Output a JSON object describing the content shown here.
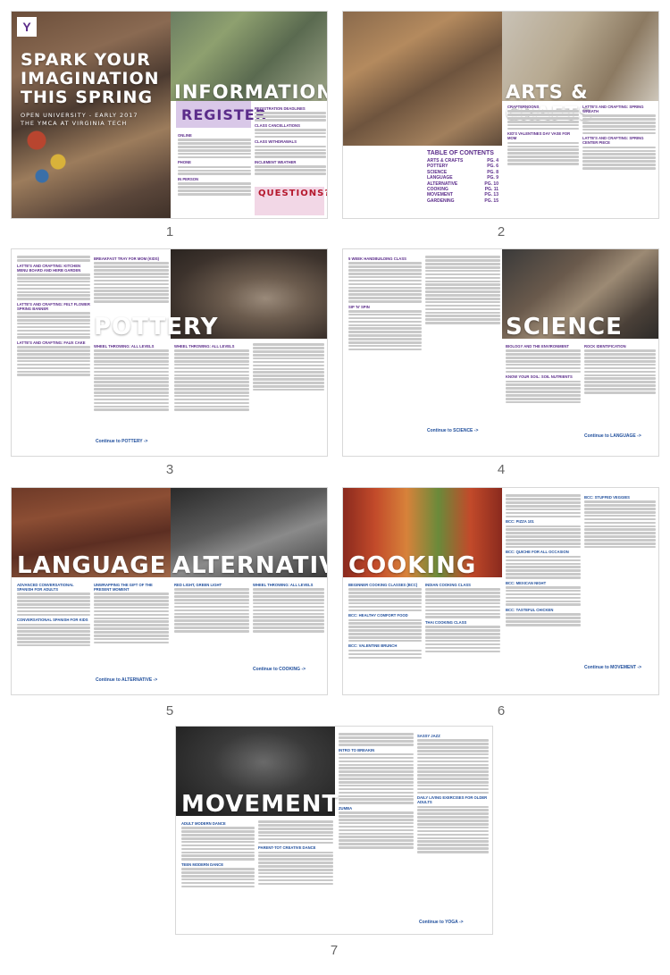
{
  "cover": {
    "headline": "SPARK YOUR IMAGINATION THIS SPRING",
    "line1": "OPEN UNIVERSITY - EARLY 2017",
    "line2": "THE YMCA AT VIRGINIA TECH",
    "logo": "Y",
    "section_title": "INFORMATION",
    "register_title": "REGISTER",
    "questions_title": "QUESTIONS?",
    "sub_online": "ONLINE",
    "sub_phone": "PHONE",
    "sub_in_person": "IN PERSON",
    "col_heads": [
      "REGISTRATION DEADLINES",
      "CLASS CANCELLATIONS",
      "CLASS WITHDRAWALS",
      "INCLEMENT WEATHER"
    ]
  },
  "arts": {
    "section_title": "ARTS & CRAFTS",
    "heads": [
      "CRAFTERNOONS",
      "KID'S VALENTINES DAY VASE FOR MOM",
      "LATTE'S AND CRAFTING: SPRING WREATH",
      "LATTE'S AND CRAFTING: SPRING CENTER PIECE"
    ],
    "toc_title": "TABLE OF CONTENTS",
    "toc": [
      {
        "label": "ARTS & CRAFTS",
        "page": "PG. 4"
      },
      {
        "label": "POTTERY",
        "page": "PG. 6"
      },
      {
        "label": "SCIENCE",
        "page": "PG. 8"
      },
      {
        "label": "LANGUAGE",
        "page": "PG. 9"
      },
      {
        "label": "ALTERNATIVE",
        "page": "PG. 10"
      },
      {
        "label": "COOKING",
        "page": "PG. 11"
      },
      {
        "label": "MOVEMENT",
        "page": "PG. 13"
      },
      {
        "label": "GARDENING",
        "page": "PG. 15"
      }
    ]
  },
  "pottery": {
    "section_title": "POTTERY",
    "heads": [
      "LATTE'S AND CRAFTING: KITCHEN MENU BOARD AND HERB GARDEN",
      "LATTE'S AND CRAFTING: FELT FLOWER SPRING BANNER",
      "LATTE'S AND CRAFTING: FAUX CAKE",
      "BREAKFAST TRAY FOR MOM (KIDS)",
      "WHEEL THROWING: ALL LEVELS",
      "WHEEL THROWING: ALL LEVELS"
    ],
    "continue": "Continue to POTTERY ->"
  },
  "science": {
    "section_title": "SCIENCE",
    "heads": [
      "5 WEEK HANDBUILDING CLASS",
      "SIP 'N' SPIN",
      "BIOLOGY AND THE ENVIRONMENT",
      "KNOW YOUR SOIL: SOIL NUTRIENTS",
      "ROCK IDENTIFICATION"
    ],
    "continue1": "Continue to SCIENCE ->",
    "continue2": "Continue to LANGUAGE ->"
  },
  "language": {
    "section_title_1": "LANGUAGE",
    "section_title_2": "ALTERNATIVE",
    "heads": [
      "ADVANCED CONVERSATIONAL SPANISH FOR ADULTS",
      "CONVERSATIONAL SPANISH FOR KIDS",
      "UNWRAPPING THE GIFT OF THE PRESENT MOMENT",
      "RED LIGHT, GREEN LIGHT",
      "WHEEL THROWING: ALL LEVELS"
    ],
    "continue1": "Continue to ALTERNATIVE ->",
    "continue2": "Continue to COOKING ->"
  },
  "cooking": {
    "section_title": "COOKING",
    "heads": [
      "BEGINNER COOKING CLASSES (BCC)",
      "BCC: HEALTHY COMFORT FOOD",
      "BCC: VALENTINE BRUNCH",
      "INDIAN COOKING CLASS",
      "THAI COOKING CLASS",
      "BCC: STUFFED VEGGIES",
      "BCC: PIZZA 101",
      "BCC: QUICHE FOR ALL OCCASION",
      "BCC: MEXICAN NIGHT",
      "BCC: TASTEFUL CHICKEN"
    ],
    "continue": "Continue to MOVEMENT ->"
  },
  "movement": {
    "section_title": "MOVEMENT",
    "heads": [
      "ADULT MODERN DANCE",
      "TEEN MODERN DANCE",
      "PARENT-TOT CREATIVE DANCE",
      "INTRO TO BREAKIN",
      "ZUMBA",
      "SASSY JAZZ",
      "DAILY LIVING EXERCISES FOR OLDER ADULTS"
    ],
    "continue": "Continue to YOGA ->"
  },
  "page_numbers": [
    "1",
    "2",
    "3",
    "4",
    "5",
    "6",
    "7"
  ],
  "colors": {
    "purple": "#5b2c8a",
    "blue": "#1f4e9c",
    "red": "#b5182d"
  }
}
